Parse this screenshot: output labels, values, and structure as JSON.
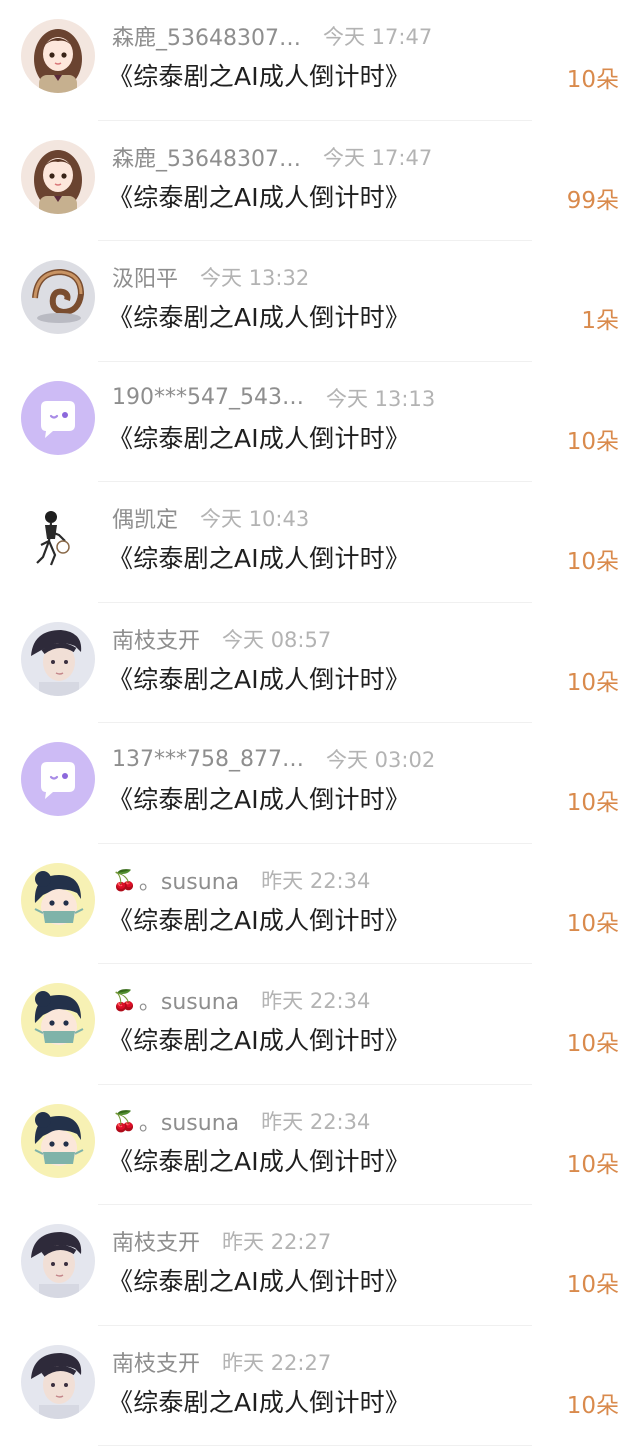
{
  "gifts": [
    {
      "avatar": "avatar-girl-uniform",
      "user": "森鹿_53648307…",
      "time": "今天 17:47",
      "book": "《综泰剧之AI成人倒计时》",
      "flowers": "10朵"
    },
    {
      "avatar": "avatar-girl-uniform",
      "user": "森鹿_53648307…",
      "time": "今天 17:47",
      "book": "《综泰剧之AI成人倒计时》",
      "flowers": "99朵"
    },
    {
      "avatar": "avatar-nautilus-shell",
      "user": "汲阳平",
      "time": "今天 13:32",
      "book": "《综泰剧之AI成人倒计时》",
      "flowers": "1朵"
    },
    {
      "avatar": "avatar-default-chat",
      "user": "190***547_543…",
      "time": "今天 13:13",
      "book": "《综泰剧之AI成人倒计时》",
      "flowers": "10朵"
    },
    {
      "avatar": "avatar-sketch-figure",
      "user": "偶凯定",
      "time": "今天 10:43",
      "book": "《综泰剧之AI成人倒计时》",
      "flowers": "10朵"
    },
    {
      "avatar": "avatar-young-man",
      "user": "南枝支开",
      "time": "今天 08:57",
      "book": "《综泰剧之AI成人倒计时》",
      "flowers": "10朵"
    },
    {
      "avatar": "avatar-default-chat",
      "user": "137***758_877…",
      "time": "今天 03:02",
      "book": "《综泰剧之AI成人倒计时》",
      "flowers": "10朵"
    },
    {
      "avatar": "avatar-cartoon-masked",
      "user": "。susuna",
      "time": "昨天 22:34",
      "book": "《综泰剧之AI成人倒计时》",
      "flowers": "10朵",
      "cherry": "🍒"
    },
    {
      "avatar": "avatar-cartoon-masked",
      "user": "。susuna",
      "time": "昨天 22:34",
      "book": "《综泰剧之AI成人倒计时》",
      "flowers": "10朵",
      "cherry": "🍒"
    },
    {
      "avatar": "avatar-cartoon-masked",
      "user": "。susuna",
      "time": "昨天 22:34",
      "book": "《综泰剧之AI成人倒计时》",
      "flowers": "10朵",
      "cherry": "🍒"
    },
    {
      "avatar": "avatar-young-man",
      "user": "南枝支开",
      "time": "昨天 22:27",
      "book": "《综泰剧之AI成人倒计时》",
      "flowers": "10朵"
    },
    {
      "avatar": "avatar-young-man",
      "user": "南枝支开",
      "time": "昨天 22:27",
      "book": "《综泰剧之AI成人倒计时》",
      "flowers": "10朵"
    }
  ],
  "colors": {
    "flowers": "#d98a4c",
    "username": "#8e8e8e",
    "time": "#b3b3b3",
    "book": "#1f1f1f",
    "default_avatar_bg": "#cdbbf5"
  }
}
